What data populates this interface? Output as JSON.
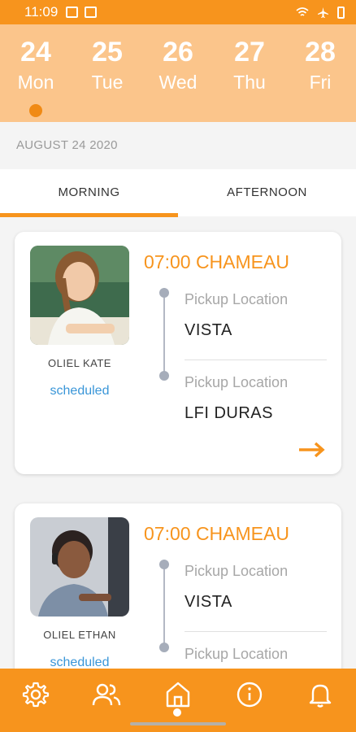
{
  "status_bar": {
    "time": "11:09"
  },
  "dates": [
    {
      "day": "24",
      "weekday": "Mon",
      "selected": true
    },
    {
      "day": "25",
      "weekday": "Tue",
      "selected": false
    },
    {
      "day": "26",
      "weekday": "Wed",
      "selected": false
    },
    {
      "day": "27",
      "weekday": "Thu",
      "selected": false
    },
    {
      "day": "28",
      "weekday": "Fri",
      "selected": false
    }
  ],
  "selected_date": "AUGUST 24 2020",
  "tabs": [
    {
      "label": "MORNING",
      "active": true
    },
    {
      "label": "AFTERNOON",
      "active": false
    }
  ],
  "trips": [
    {
      "student_name": "OLIEL KATE",
      "status": "scheduled",
      "title": "07:00 CHAMEAU",
      "stops": [
        {
          "label": "Pickup Location",
          "name": "VISTA"
        },
        {
          "label": "Pickup Location",
          "name": "LFI DURAS"
        }
      ]
    },
    {
      "student_name": "OLIEL ETHAN",
      "status": "scheduled",
      "title": "07:00 CHAMEAU",
      "stops": [
        {
          "label": "Pickup Location",
          "name": "VISTA"
        },
        {
          "label": "Pickup Location",
          "name": ""
        }
      ]
    }
  ],
  "bottom_nav": [
    {
      "icon": "settings-icon",
      "active": false
    },
    {
      "icon": "users-icon",
      "active": false
    },
    {
      "icon": "home-icon",
      "active": true
    },
    {
      "icon": "info-icon",
      "active": false
    },
    {
      "icon": "bell-icon",
      "active": false
    }
  ],
  "colors": {
    "primary": "#f7941d",
    "date_strip": "#fbc58b",
    "status_text": "#3a96d8",
    "background": "#f4f4f4"
  }
}
